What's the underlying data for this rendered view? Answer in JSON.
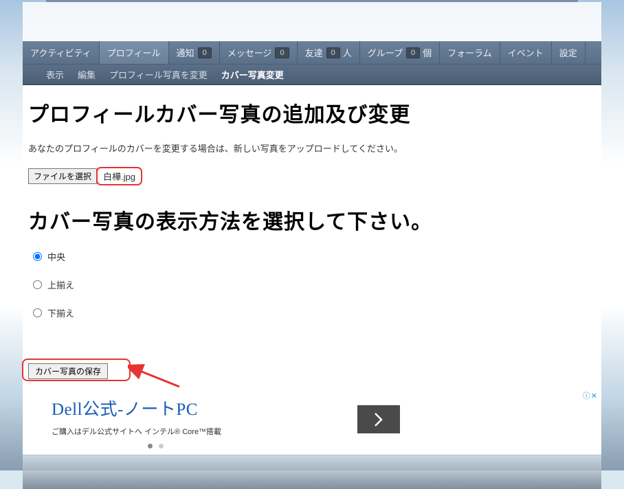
{
  "nav": {
    "tabs": [
      {
        "label": "アクティビティ",
        "badge": null,
        "suffix": null,
        "active": false
      },
      {
        "label": "プロフィール",
        "badge": null,
        "suffix": null,
        "active": true
      },
      {
        "label": "通知",
        "badge": "0",
        "suffix": null,
        "active": false
      },
      {
        "label": "メッセージ",
        "badge": "0",
        "suffix": null,
        "active": false
      },
      {
        "label": "友達",
        "badge": "0",
        "suffix": "人",
        "active": false
      },
      {
        "label": "グループ",
        "badge": "0",
        "suffix": "個",
        "active": false
      },
      {
        "label": "フォーラム",
        "badge": null,
        "suffix": null,
        "active": false
      },
      {
        "label": "イベント",
        "badge": null,
        "suffix": null,
        "active": false
      },
      {
        "label": "設定",
        "badge": null,
        "suffix": null,
        "active": false
      }
    ]
  },
  "subnav": {
    "items": [
      {
        "label": "表示",
        "active": false
      },
      {
        "label": "編集",
        "active": false
      },
      {
        "label": "プロフィール写真を変更",
        "active": false
      },
      {
        "label": "カバー写真変更",
        "active": true
      }
    ]
  },
  "page": {
    "title": "プロフィールカバー写真の追加及び変更",
    "description": "あなたのプロフィールのカバーを変更する場合は、新しい写真をアップロードしてください。",
    "file_button": "ファイルを選択",
    "filename": "白樺.jpg",
    "section_title": "カバー写真の表示方法を選択して下さい。",
    "radios": [
      {
        "label": "中央",
        "checked": true
      },
      {
        "label": "上揃え",
        "checked": false
      },
      {
        "label": "下揃え",
        "checked": false
      }
    ],
    "save_button": "カバー写真の保存"
  },
  "ad": {
    "title": "Dell公式-ノートPC",
    "subtitle": "ご購入はデル公式サイトへ インテル® Core™搭載"
  }
}
